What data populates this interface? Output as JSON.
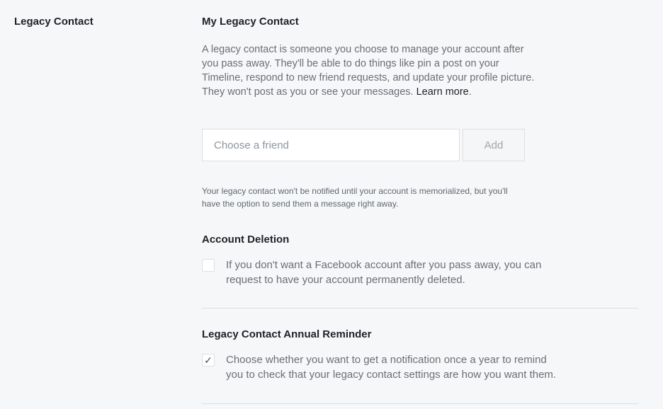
{
  "section_label": "Legacy Contact",
  "legacy": {
    "title": "My Legacy Contact",
    "description_line1": "A legacy contact is someone you choose to manage your account after",
    "description_line2": "you pass away. They'll be able to do things like pin a post on your",
    "description_line3": "Timeline, respond to new friend requests, and update your profile picture.",
    "description_line4": "They won't post as you or see your messages.",
    "learn_more": "Learn more",
    "learn_more_suffix": ".",
    "input_placeholder": "Choose a friend",
    "add_label": "Add",
    "note_line1": "Your legacy contact won't be notified until your account is memorialized, but you'll",
    "note_line2": "have the option to send them a message right away."
  },
  "deletion": {
    "title": "Account Deletion",
    "checked": false,
    "text_line1": "If you don't want a Facebook account after you pass away, you can",
    "text_line2": "request to have your account permanently deleted."
  },
  "reminder": {
    "title": "Legacy Contact Annual Reminder",
    "checked": true,
    "check_glyph": "✓",
    "text_line1": "Choose whether you want to get a notification once a year to remind",
    "text_line2": "you to check that your legacy contact settings are how you want them."
  }
}
